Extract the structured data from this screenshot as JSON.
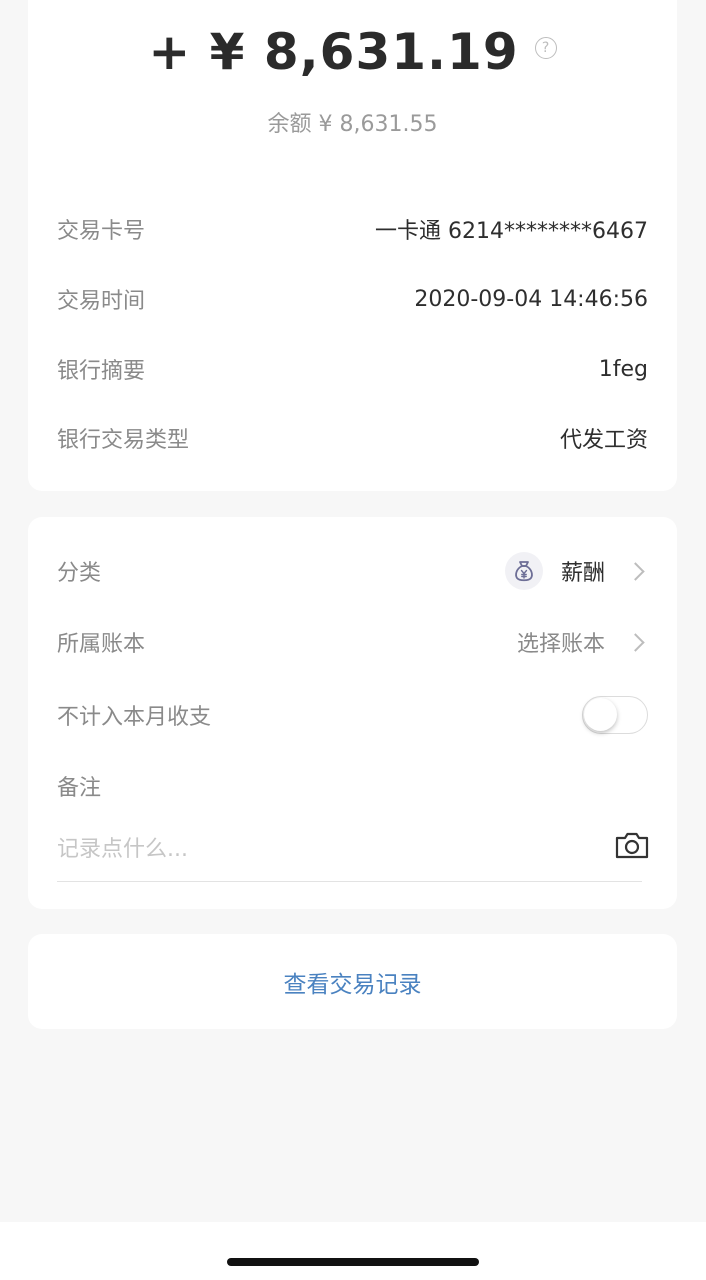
{
  "transaction": {
    "amount": "+ ¥ 8,631.19",
    "balance": "余额 ¥ 8,631.55",
    "help_glyph": "?",
    "details": [
      {
        "label": "交易卡号",
        "value": "一卡通 6214********6467"
      },
      {
        "label": "交易时间",
        "value": "2020-09-04 14:46:56"
      },
      {
        "label": "银行摘要",
        "value": "1feg"
      },
      {
        "label": "银行交易类型",
        "value": "代发工资"
      }
    ]
  },
  "settings": {
    "category": {
      "label": "分类",
      "value": "薪酬",
      "icon": "money-bag-icon"
    },
    "ledger": {
      "label": "所属账本",
      "value": "选择账本"
    },
    "exclude": {
      "label": "不计入本月收支",
      "enabled": false
    },
    "note": {
      "label": "备注",
      "placeholder": "记录点什么...",
      "value": ""
    }
  },
  "history": {
    "label": "查看交易记录"
  },
  "colors": {
    "link": "#4a82c0",
    "background": "#f7f7f7",
    "icon": "#6d6e96"
  }
}
